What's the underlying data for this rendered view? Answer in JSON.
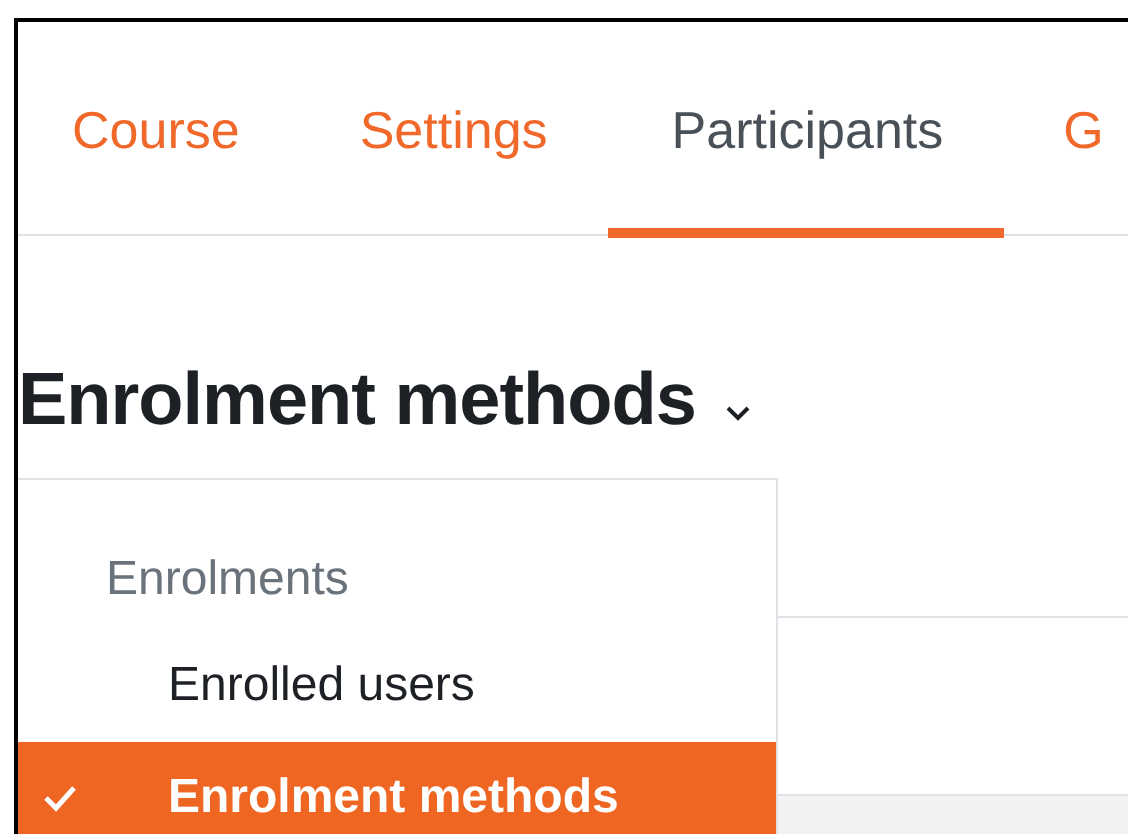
{
  "tabs": [
    {
      "label": "Course",
      "selected": false
    },
    {
      "label": "Settings",
      "selected": false
    },
    {
      "label": "Participants",
      "selected": true
    },
    {
      "label": "G",
      "selected": false
    }
  ],
  "heading": {
    "title": "Enrolment methods",
    "expanded": true
  },
  "menu": {
    "group": "Enrolments",
    "items": [
      {
        "label": "Enrolled users",
        "selected": false
      },
      {
        "label": "Enrolment methods",
        "selected": true
      }
    ]
  }
}
